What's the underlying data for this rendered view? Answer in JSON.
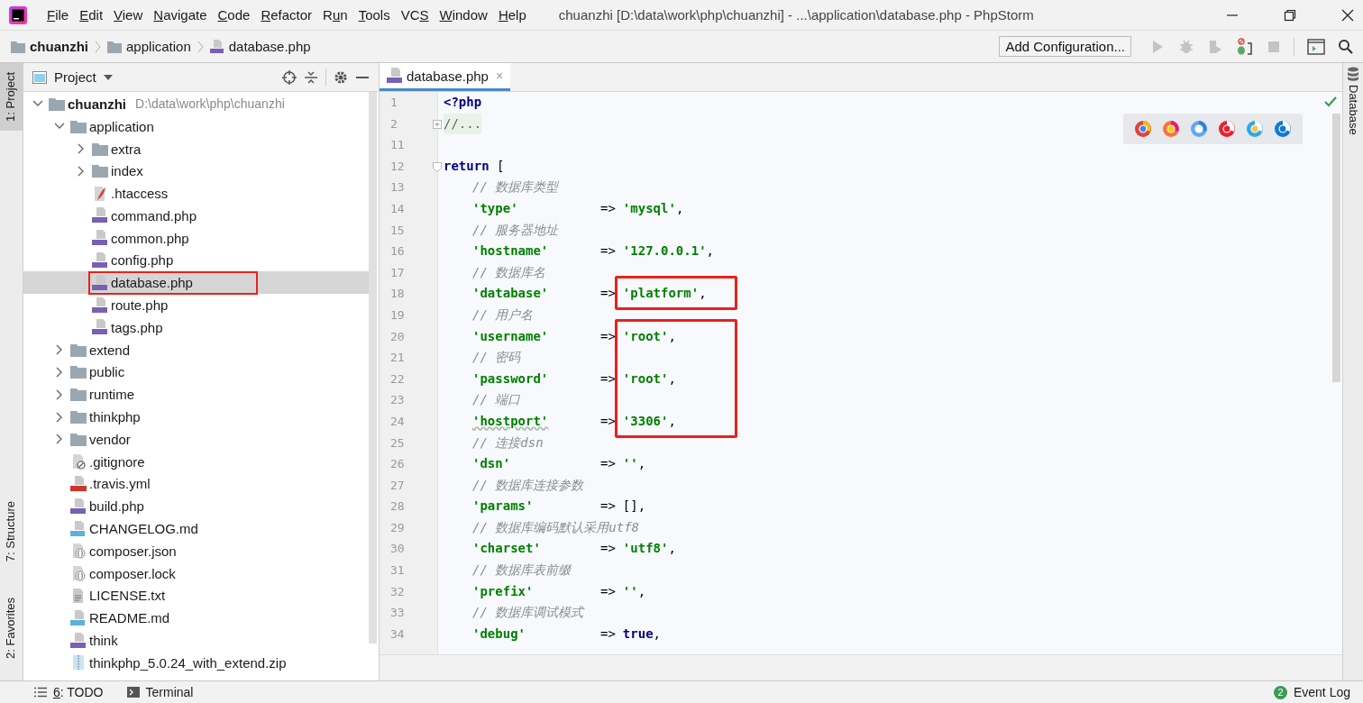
{
  "window": {
    "title": "chuanzhi [D:\\data\\work\\php\\chuanzhi] - ...\\application\\database.php - PhpStorm"
  },
  "menu": [
    {
      "key": "F",
      "post": "ile"
    },
    {
      "key": "E",
      "post": "dit"
    },
    {
      "key": "V",
      "post": "iew"
    },
    {
      "key": "N",
      "post": "avigate"
    },
    {
      "key": "C",
      "post": "ode"
    },
    {
      "key": "R",
      "post": "efactor"
    },
    {
      "pre": "R",
      "key": "u",
      "post": "n"
    },
    {
      "key": "T",
      "post": "ools"
    },
    {
      "pre": "VC",
      "key": "S"
    },
    {
      "key": "W",
      "post": "indow"
    },
    {
      "key": "H",
      "post": "elp"
    }
  ],
  "breadcrumbs": [
    {
      "label": "chuanzhi",
      "kind": "folder",
      "bold": true
    },
    {
      "label": "application",
      "kind": "folder",
      "bold": false
    },
    {
      "label": "database.php",
      "kind": "php",
      "bold": false
    }
  ],
  "run_config": {
    "label": "Add Configuration..."
  },
  "left_stripe": {
    "top": [
      {
        "label": "1: Project",
        "selected": true
      }
    ],
    "bottom": [
      {
        "label": "7: Structure",
        "selected": false
      },
      {
        "label": "2: Favorites",
        "selected": false
      }
    ]
  },
  "project_panel": {
    "title": "Project"
  },
  "tree": [
    {
      "name": "chuanzhi",
      "kind": "project",
      "hint": "D:\\data\\work\\php\\chuanzhi",
      "expanded": true,
      "selected": false,
      "boxed": false,
      "children": [
        {
          "name": "application",
          "kind": "folder",
          "expanded": true,
          "selected": false,
          "boxed": false,
          "children": [
            {
              "name": "extra",
              "kind": "folder",
              "expanded": false,
              "selected": false,
              "boxed": false
            },
            {
              "name": "index",
              "kind": "folder",
              "expanded": false,
              "selected": false,
              "boxed": false
            },
            {
              "name": ".htaccess",
              "kind": "htaccess",
              "selected": false,
              "boxed": false
            },
            {
              "name": "command.php",
              "kind": "php",
              "selected": false,
              "boxed": false
            },
            {
              "name": "common.php",
              "kind": "php",
              "selected": false,
              "boxed": false
            },
            {
              "name": "config.php",
              "kind": "php",
              "selected": false,
              "boxed": false
            },
            {
              "name": "database.php",
              "kind": "php",
              "selected": true,
              "boxed": true
            },
            {
              "name": "route.php",
              "kind": "php",
              "selected": false,
              "boxed": false
            },
            {
              "name": "tags.php",
              "kind": "php",
              "selected": false,
              "boxed": false
            }
          ]
        },
        {
          "name": "extend",
          "kind": "folder",
          "expanded": false,
          "selected": false,
          "boxed": false
        },
        {
          "name": "public",
          "kind": "folder",
          "expanded": false,
          "selected": false,
          "boxed": false
        },
        {
          "name": "runtime",
          "kind": "folder",
          "expanded": false,
          "selected": false,
          "boxed": false
        },
        {
          "name": "thinkphp",
          "kind": "folder",
          "expanded": false,
          "selected": false,
          "boxed": false
        },
        {
          "name": "vendor",
          "kind": "folder",
          "expanded": false,
          "selected": false,
          "boxed": false
        },
        {
          "name": ".gitignore",
          "kind": "git",
          "selected": false,
          "boxed": false
        },
        {
          "name": ".travis.yml",
          "kind": "yml",
          "selected": false,
          "boxed": false
        },
        {
          "name": "build.php",
          "kind": "php",
          "selected": false,
          "boxed": false
        },
        {
          "name": "CHANGELOG.md",
          "kind": "md",
          "selected": false,
          "boxed": false
        },
        {
          "name": "composer.json",
          "kind": "json",
          "selected": false,
          "boxed": false
        },
        {
          "name": "composer.lock",
          "kind": "json",
          "selected": false,
          "boxed": false
        },
        {
          "name": "LICENSE.txt",
          "kind": "txt",
          "selected": false,
          "boxed": false
        },
        {
          "name": "README.md",
          "kind": "md",
          "selected": false,
          "boxed": false
        },
        {
          "name": "think",
          "kind": "php",
          "selected": false,
          "boxed": false
        },
        {
          "name": "thinkphp_5.0.24_with_extend.zip",
          "kind": "zip",
          "selected": false,
          "boxed": false
        }
      ]
    }
  ],
  "tabs": [
    {
      "label": "database.php",
      "close": "×",
      "selected": true
    }
  ],
  "right_stripe": [
    {
      "label": "Database",
      "selected": false
    }
  ],
  "code": [
    {
      "num": "1",
      "kind": "code",
      "boxed": false,
      "tokens": [
        {
          "kind": "tag",
          "text": "<?php"
        }
      ]
    },
    {
      "num": "2",
      "kind": "code",
      "boxed": false,
      "fold": {
        "collapsed": true
      },
      "tokens": [
        {
          "kind": "folded",
          "text": "//..."
        }
      ]
    },
    {
      "num": "11",
      "kind": "blank",
      "boxed": false
    },
    {
      "num": "12",
      "kind": "code",
      "boxed": false,
      "fold": {
        "collapsed": false
      },
      "tokens": [
        {
          "kind": "keyword",
          "text": "return"
        },
        {
          "kind": "plain",
          "text": " ["
        }
      ]
    },
    {
      "num": "13",
      "kind": "comment",
      "boxed": false,
      "text": "// 数据库类型"
    },
    {
      "num": "14",
      "kind": "pair",
      "boxed": false,
      "key": "'type'",
      "arrow": "=>",
      "value": {
        "kind": "string",
        "text": "'mysql'"
      },
      "punct": ","
    },
    {
      "num": "15",
      "kind": "comment",
      "boxed": false,
      "text": "// 服务器地址"
    },
    {
      "num": "16",
      "kind": "pair",
      "boxed": false,
      "key": "'hostname'",
      "arrow": "=>",
      "value": {
        "kind": "string",
        "text": "'127.0.0.1'"
      },
      "punct": ","
    },
    {
      "num": "17",
      "kind": "comment",
      "boxed": false,
      "text": "// 数据库名"
    },
    {
      "num": "18",
      "kind": "pair",
      "boxed": true,
      "key": "'database'",
      "arrow": "=>",
      "value": {
        "kind": "string",
        "text": "'platform'"
      },
      "punct": ","
    },
    {
      "num": "19",
      "kind": "comment",
      "boxed": false,
      "text": "// 用户名"
    },
    {
      "num": "20",
      "kind": "pair",
      "boxed": true,
      "key": "'username'",
      "arrow": "=>",
      "value": {
        "kind": "string",
        "text": "'root'"
      },
      "punct": ","
    },
    {
      "num": "21",
      "kind": "comment",
      "boxed": true,
      "text": "// 密码"
    },
    {
      "num": "22",
      "kind": "pair",
      "boxed": true,
      "key": "'password'",
      "arrow": "=>",
      "value": {
        "kind": "string",
        "text": "'root'"
      },
      "punct": ","
    },
    {
      "num": "23",
      "kind": "comment",
      "boxed": true,
      "text": "// 端口"
    },
    {
      "num": "24",
      "kind": "pair",
      "boxed": true,
      "typo": true,
      "key": "'hostport'",
      "arrow": "=>",
      "value": {
        "kind": "string",
        "text": "'3306'"
      },
      "punct": ","
    },
    {
      "num": "25",
      "kind": "comment",
      "boxed": false,
      "text": "// 连接dsn"
    },
    {
      "num": "26",
      "kind": "pair",
      "boxed": false,
      "key": "'dsn'",
      "arrow": "=>",
      "value": {
        "kind": "string",
        "text": "''"
      },
      "punct": ","
    },
    {
      "num": "27",
      "kind": "comment",
      "boxed": false,
      "text": "// 数据库连接参数"
    },
    {
      "num": "28",
      "kind": "pair",
      "boxed": false,
      "key": "'params'",
      "arrow": "=>",
      "value": {
        "kind": "plain",
        "text": "[]"
      },
      "punct": ","
    },
    {
      "num": "29",
      "kind": "comment",
      "boxed": false,
      "text": "// 数据库编码默认采用utf8"
    },
    {
      "num": "30",
      "kind": "pair",
      "boxed": false,
      "key": "'charset'",
      "arrow": "=>",
      "value": {
        "kind": "string",
        "text": "'utf8'"
      },
      "punct": ","
    },
    {
      "num": "31",
      "kind": "comment",
      "boxed": false,
      "text": "// 数据库表前缀"
    },
    {
      "num": "32",
      "kind": "pair",
      "boxed": false,
      "key": "'prefix'",
      "arrow": "=>",
      "value": {
        "kind": "string",
        "text": "''"
      },
      "punct": ","
    },
    {
      "num": "33",
      "kind": "comment",
      "boxed": false,
      "text": "// 数据库调试模式"
    },
    {
      "num": "34",
      "kind": "pair",
      "boxed": false,
      "key": "'debug'",
      "arrow": "=>",
      "value": {
        "kind": "keyword",
        "text": "true"
      },
      "punct": ","
    }
  ],
  "bottom_bar": [
    {
      "kind": "todo",
      "key": "6",
      "post": ": TODO"
    },
    {
      "kind": "terminal",
      "post": "Terminal"
    }
  ],
  "event_log": {
    "label": "Event Log",
    "count": "2"
  }
}
